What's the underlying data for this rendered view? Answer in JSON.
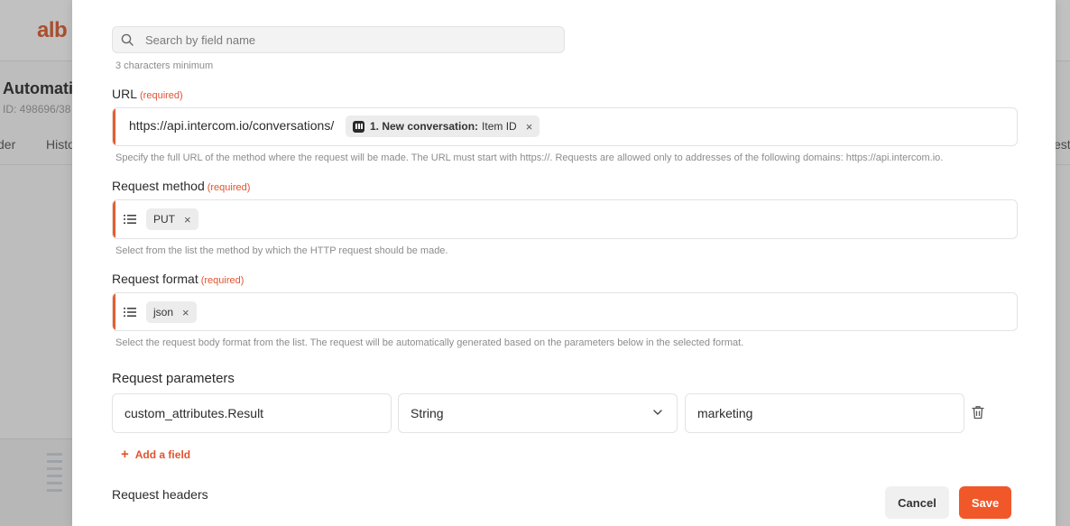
{
  "background": {
    "logo": "alb",
    "title": "Automati",
    "id_text": "ID: 498696/38",
    "tabs": [
      "der",
      "Histo",
      "est"
    ]
  },
  "search": {
    "placeholder": "Search by field name",
    "hint": "3 characters minimum"
  },
  "url_field": {
    "label": "URL",
    "required": "(required)",
    "base_url": "https://api.intercom.io/conversations/",
    "chip_step": "1. New conversation:",
    "chip_value": "Item ID",
    "hint": "Specify the full URL of the method where the request will be made. The URL must start with https://. Requests are allowed only to addresses of the following domains: https://api.intercom.io."
  },
  "method_field": {
    "label": "Request method",
    "required": "(required)",
    "value": "PUT",
    "hint": "Select from the list the method by which the HTTP request should be made."
  },
  "format_field": {
    "label": "Request format",
    "required": "(required)",
    "value": "json",
    "hint": "Select the request body format from the list. The request will be automatically generated based on the parameters below in the selected format."
  },
  "parameters": {
    "title": "Request parameters",
    "rows": [
      {
        "name": "custom_attributes.Result",
        "type": "String",
        "value": "marketing"
      }
    ],
    "add_label": "Add a field"
  },
  "headers": {
    "title": "Request headers"
  },
  "actions": {
    "cancel": "Cancel",
    "save": "Save"
  },
  "colors": {
    "accent": "#f0582a",
    "required": "#e2532f",
    "chip_bg": "#ececec"
  },
  "icons": [
    "search-icon",
    "intercom-icon",
    "close-icon",
    "list-icon",
    "chevron-down-icon",
    "trash-icon",
    "plus-icon"
  ]
}
